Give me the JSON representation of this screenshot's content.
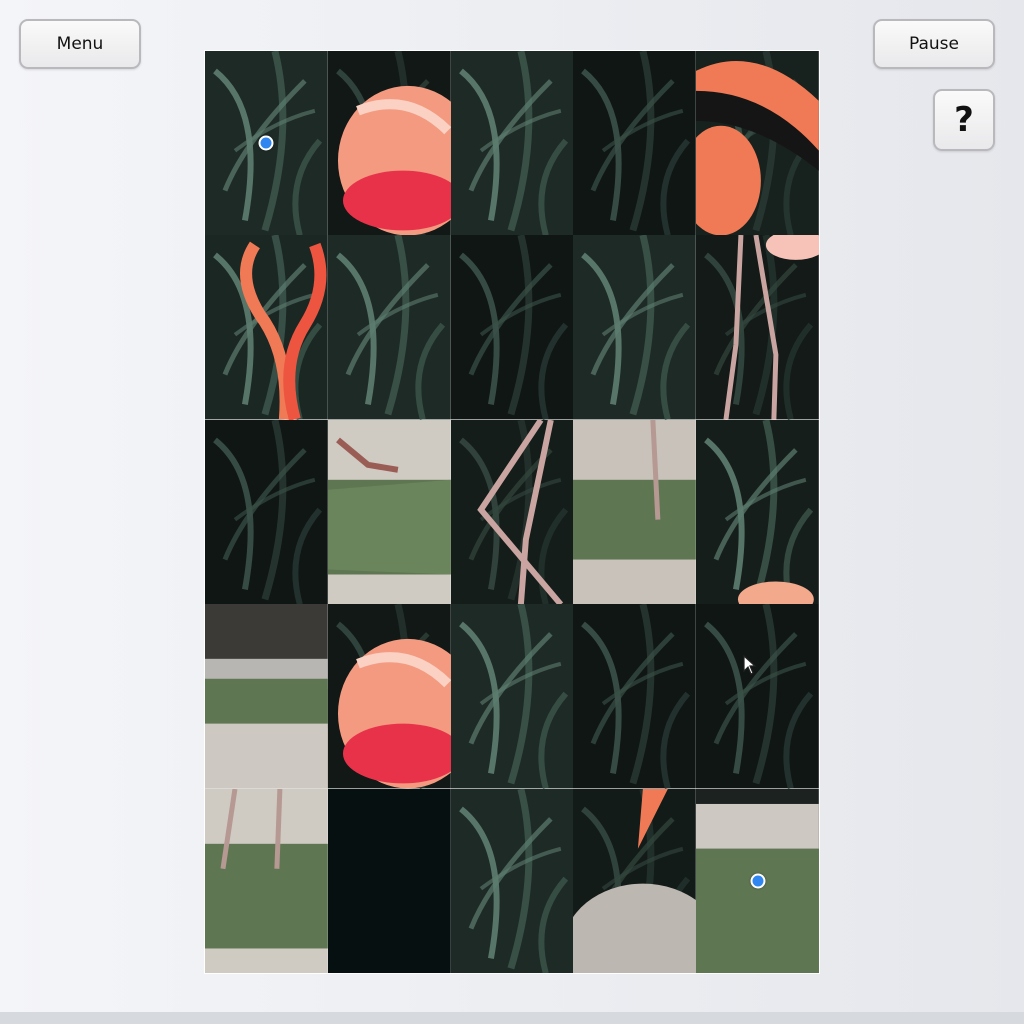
{
  "toolbar": {
    "menu_label": "Menu",
    "pause_label": "Pause",
    "help_label": "?"
  },
  "puzzle": {
    "rows": 5,
    "cols": 5,
    "tiles": [
      {
        "kind": "leaves"
      },
      {
        "kind": "flamingo-body"
      },
      {
        "kind": "leaves"
      },
      {
        "kind": "leaves-dark"
      },
      {
        "kind": "flamingo-wing"
      },
      {
        "kind": "flamingo-necks"
      },
      {
        "kind": "leaves"
      },
      {
        "kind": "leaves-dark"
      },
      {
        "kind": "leaves"
      },
      {
        "kind": "flamingo-legs"
      },
      {
        "kind": "leaves-dark"
      },
      {
        "kind": "grass-foot"
      },
      {
        "kind": "flamingo-knee"
      },
      {
        "kind": "grass-leg"
      },
      {
        "kind": "leaves-head"
      },
      {
        "kind": "grass-water"
      },
      {
        "kind": "flamingo-body"
      },
      {
        "kind": "leaves"
      },
      {
        "kind": "leaves-dark"
      },
      {
        "kind": "leaves-dark"
      },
      {
        "kind": "grass-legs"
      },
      {
        "kind": "dark"
      },
      {
        "kind": "leaves"
      },
      {
        "kind": "rock-feather"
      },
      {
        "kind": "grass"
      }
    ],
    "markers": [
      {
        "tile": 0,
        "color": "#2f86f0"
      },
      {
        "tile": 24,
        "color": "#2f86f0"
      }
    ]
  },
  "colors": {
    "accent": "#2f86f0",
    "flamingo": "#f07a55",
    "foliage": "#3f5a4f"
  }
}
